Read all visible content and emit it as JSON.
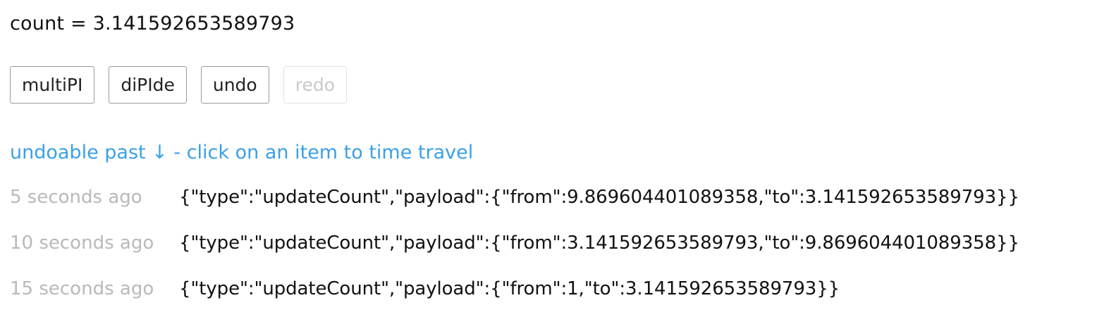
{
  "counter": {
    "label": "count = 3.141592653589793"
  },
  "buttons": [
    {
      "label": "multiPI",
      "enabled": true
    },
    {
      "label": "diPIde",
      "enabled": true
    },
    {
      "label": "undo",
      "enabled": true
    },
    {
      "label": "redo",
      "enabled": false
    }
  ],
  "history": {
    "header": "undoable past ↓ - click on an item to time travel",
    "items": [
      {
        "time": "5 seconds ago",
        "action": "{\"type\":\"updateCount\",\"payload\":{\"from\":9.869604401089358,\"to\":3.141592653589793}}"
      },
      {
        "time": "10 seconds ago",
        "action": "{\"type\":\"updateCount\",\"payload\":{\"from\":3.141592653589793,\"to\":9.869604401089358}}"
      },
      {
        "time": "15 seconds ago",
        "action": "{\"type\":\"updateCount\",\"payload\":{\"from\":1,\"to\":3.141592653589793}}"
      }
    ]
  },
  "colors": {
    "accent": "#3ba0e6",
    "muted": "#b9b9b9",
    "disabled": "#c9c9c9"
  }
}
